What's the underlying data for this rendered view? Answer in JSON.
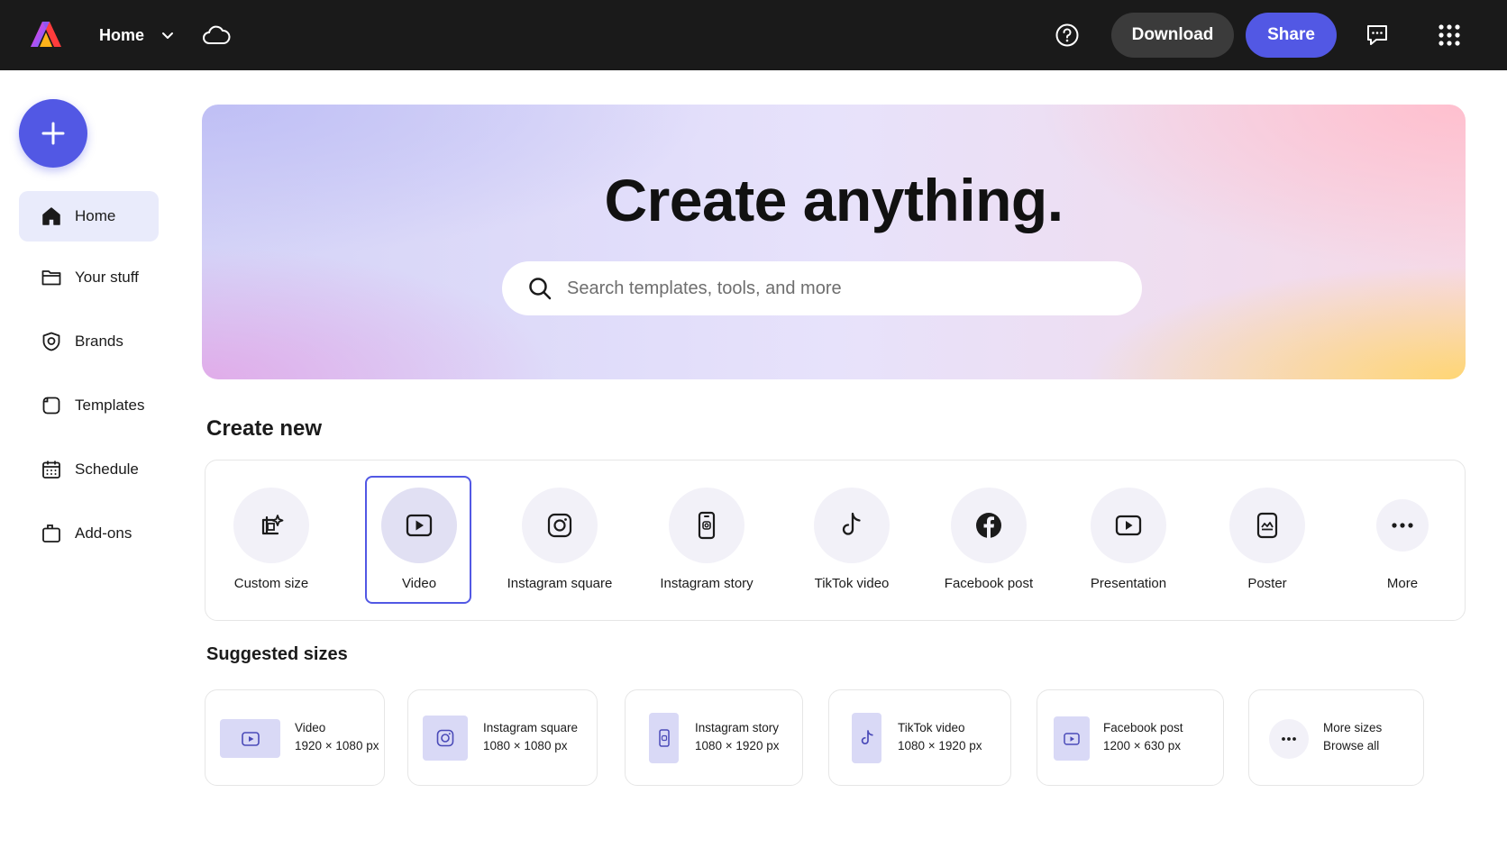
{
  "topbar": {
    "nav_label": "Home",
    "download_label": "Download",
    "share_label": "Share"
  },
  "sidebar": {
    "items": [
      {
        "label": "Home",
        "icon": "home-icon",
        "active": true
      },
      {
        "label": "Your stuff",
        "icon": "folder-icon"
      },
      {
        "label": "Brands",
        "icon": "brand-shield-icon"
      },
      {
        "label": "Templates",
        "icon": "templates-icon"
      },
      {
        "label": "Schedule",
        "icon": "calendar-icon"
      },
      {
        "label": "Add-ons",
        "icon": "addons-icon"
      }
    ]
  },
  "hero": {
    "title": "Create anything.",
    "search_placeholder": "Search templates, tools, and more"
  },
  "create_new": {
    "title": "Create new",
    "selected": "Video",
    "items": [
      {
        "label": "Custom size",
        "icon": "custom-size-icon"
      },
      {
        "label": "Video",
        "icon": "video-play-icon"
      },
      {
        "label": "Instagram square",
        "icon": "instagram-icon"
      },
      {
        "label": "Instagram story",
        "icon": "instagram-story-icon"
      },
      {
        "label": "TikTok video",
        "icon": "tiktok-icon"
      },
      {
        "label": "Facebook post",
        "icon": "facebook-icon"
      },
      {
        "label": "Presentation",
        "icon": "presentation-icon"
      },
      {
        "label": "Poster",
        "icon": "poster-icon"
      },
      {
        "label": "More",
        "icon": "more-dots-icon"
      }
    ]
  },
  "suggested": {
    "title": "Suggested sizes",
    "items": [
      {
        "name": "Video",
        "size": "1920 × 1080 px",
        "icon": "video-play-icon"
      },
      {
        "name": "Instagram square",
        "size": "1080 × 1080 px",
        "icon": "instagram-icon"
      },
      {
        "name": "Instagram story",
        "size": "1080 × 1920 px",
        "icon": "instagram-story-icon"
      },
      {
        "name": "TikTok video",
        "size": "1080 × 1920 px",
        "icon": "tiktok-icon"
      },
      {
        "name": "Facebook post",
        "size": "1200 × 630 px",
        "icon": "video-play-icon"
      },
      {
        "name": "More sizes",
        "size": "Browse all",
        "icon": "more-dots-icon"
      }
    ]
  },
  "colors": {
    "accent": "#5258e4",
    "topbar": "#1a1a1a",
    "active_nav_bg": "#e9ebfb"
  }
}
